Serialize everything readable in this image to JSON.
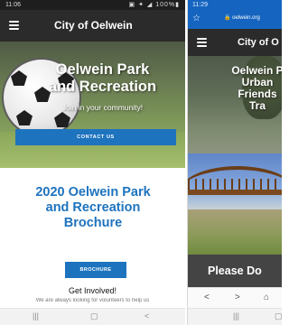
{
  "left_screen": {
    "status_bar": {
      "time": "11:06",
      "icons": "▣ ✦ ◢ 100%▮"
    },
    "app_bar": {
      "title": "City of Oelwein"
    },
    "hero": {
      "title_line1": "Oelwein Park",
      "title_line2": "and Recreation",
      "subtitle": "Join in your community!",
      "contact_button": "CONTACT US"
    },
    "brochure": {
      "title_line1": "2020 Oelwein Park",
      "title_line2": "and Recreation",
      "title_line3": "Brochure",
      "button": "BROCHURE"
    },
    "get_involved": "Get Involved!",
    "volunteer_text": "We are always looking for volunteers to help us",
    "nav": {
      "recents": "|||",
      "home": "▢",
      "back": "<"
    }
  },
  "right_screen": {
    "status_bar": {
      "time": "11:29"
    },
    "url_bar": {
      "star": "☆",
      "url": "🔒 oelwein.org"
    },
    "app_bar": {
      "title": "City of O"
    },
    "hero": {
      "line1": "Oelwein P",
      "line2": "Urban",
      "line3": "Friends",
      "line4": "Tra"
    },
    "donate_text": "Please Do",
    "browser_nav": {
      "back": "<",
      "forward": ">",
      "home": "⌂"
    },
    "nav": {
      "recents": "|||",
      "home": "▢"
    }
  }
}
